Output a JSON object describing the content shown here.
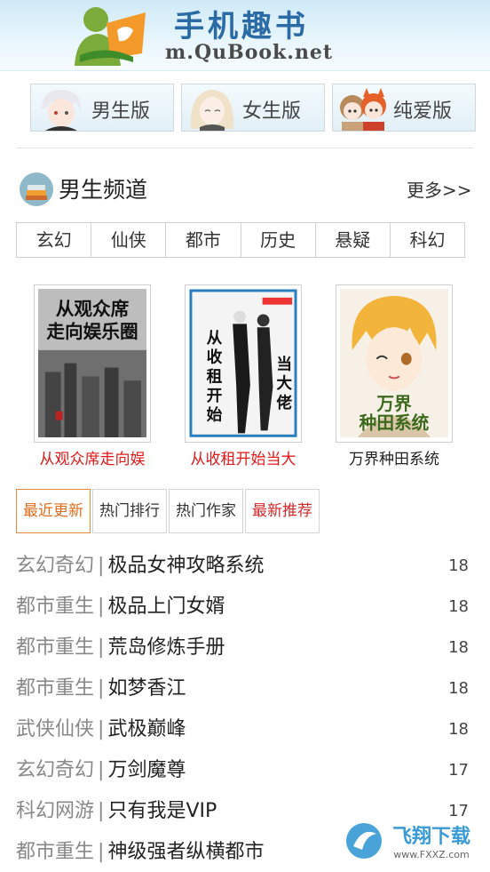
{
  "header": {
    "site_title": "手机趣书",
    "site_url": "m.QuBook.net"
  },
  "versions": [
    {
      "label": "男生版",
      "icon": "boy-avatar-icon"
    },
    {
      "label": "女生版",
      "icon": "girl-avatar-icon"
    },
    {
      "label": "纯爱版",
      "icon": "couple-avatar-icon"
    }
  ],
  "channel": {
    "title": "男生频道",
    "more": "更多>>",
    "categories": [
      "玄幻",
      "仙侠",
      "都市",
      "历史",
      "悬疑",
      "科幻"
    ]
  },
  "featured": [
    {
      "title": "从观众席走向娱",
      "cover_text": "从观众席走向娱乐圈",
      "color": "#e01818"
    },
    {
      "title": "从收租开始当大",
      "cover_text": "从收租开始当大佬",
      "color": "#e01818"
    },
    {
      "title": "万界种田系统",
      "cover_text": "万界种田系统",
      "color": "#222222"
    }
  ],
  "tabs": [
    "最近更新",
    "热门排行",
    "热门作家",
    "最新推荐"
  ],
  "list": [
    {
      "category": "玄幻奇幻",
      "name": "极品女神攻略系统",
      "count": "18"
    },
    {
      "category": "都市重生",
      "name": "极品上门女婿",
      "count": "18"
    },
    {
      "category": "都市重生",
      "name": "荒岛修炼手册",
      "count": "18"
    },
    {
      "category": "都市重生",
      "name": "如梦香江",
      "count": "18"
    },
    {
      "category": "武侠仙侠",
      "name": "武极巅峰",
      "count": "18"
    },
    {
      "category": "玄幻奇幻",
      "name": "万剑魔尊",
      "count": "17"
    },
    {
      "category": "科幻网游",
      "name": "只有我是VIP",
      "count": "17"
    },
    {
      "category": "都市重生",
      "name": "神级强者纵横都市",
      "count": ""
    }
  ],
  "separator": "|",
  "watermark": {
    "text": "飞翔下载",
    "sub": "www.FXXZ.com"
  },
  "colors": {
    "accent": "#e06d1c",
    "link_red": "#d02a2a",
    "title_blue": "#2a6aa5"
  }
}
